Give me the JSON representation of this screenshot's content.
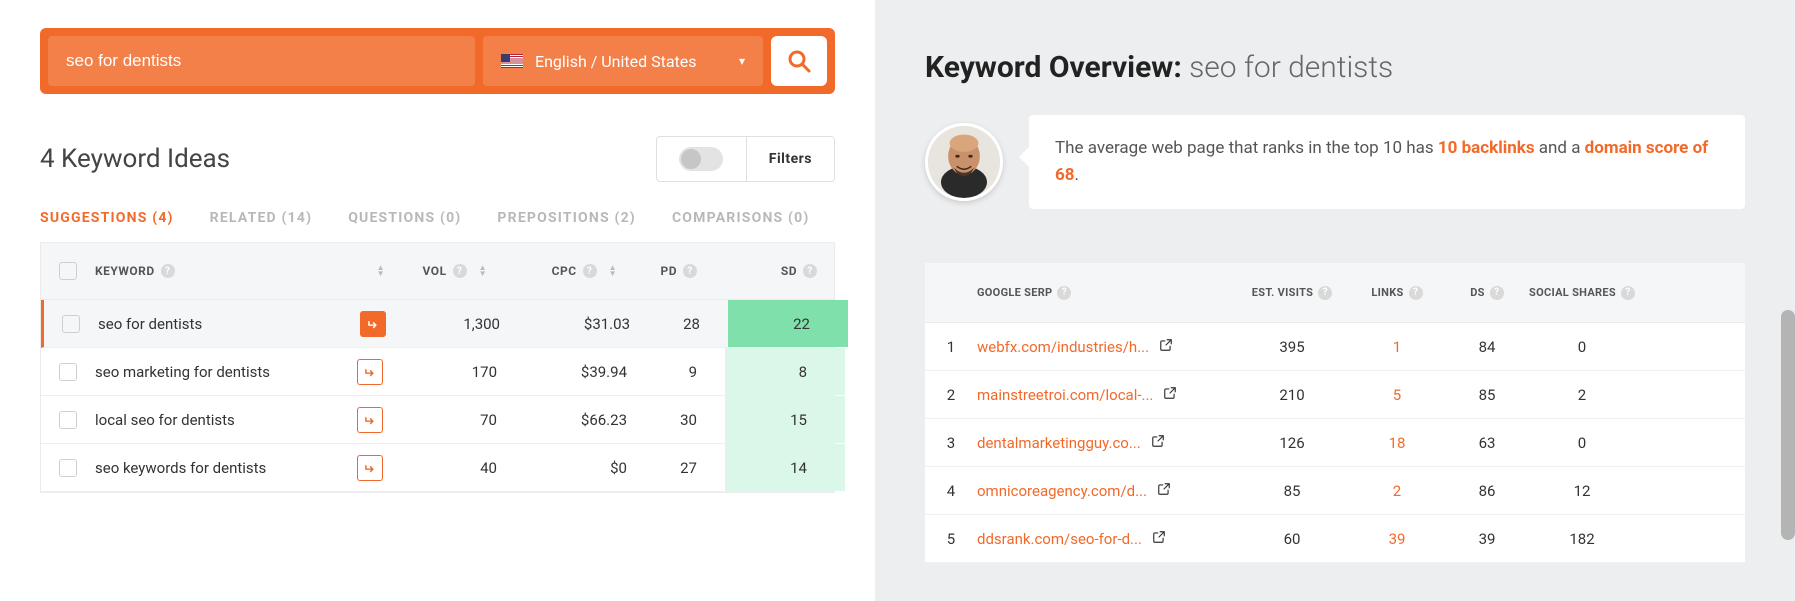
{
  "search": {
    "query": "seo for dentists",
    "language": "English / United States"
  },
  "ideas": {
    "title": "4 Keyword Ideas",
    "filters_label": "Filters"
  },
  "tabs": [
    {
      "label": "SUGGESTIONS (4)",
      "active": true
    },
    {
      "label": "RELATED (14)",
      "active": false
    },
    {
      "label": "QUESTIONS (0)",
      "active": false
    },
    {
      "label": "PREPOSITIONS (2)",
      "active": false
    },
    {
      "label": "COMPARISONS (0)",
      "active": false
    }
  ],
  "columns": {
    "keyword": "KEYWORD",
    "vol": "VOL",
    "cpc": "CPC",
    "pd": "PD",
    "sd": "SD"
  },
  "rows": [
    {
      "kw": "seo for dentists",
      "vol": "1,300",
      "cpc": "$31.03",
      "pd": "28",
      "sd": "22",
      "selected": true,
      "sd_class": "sd-dark"
    },
    {
      "kw": "seo marketing for dentists",
      "vol": "170",
      "cpc": "$39.94",
      "pd": "9",
      "sd": "8",
      "selected": false,
      "sd_class": "sd-light"
    },
    {
      "kw": "local seo for dentists",
      "vol": "70",
      "cpc": "$66.23",
      "pd": "30",
      "sd": "15",
      "selected": false,
      "sd_class": "sd-light"
    },
    {
      "kw": "seo keywords for dentists",
      "vol": "40",
      "cpc": "$0",
      "pd": "27",
      "sd": "14",
      "selected": false,
      "sd_class": "sd-light"
    }
  ],
  "overview": {
    "heading_bold": "Keyword Overview:",
    "heading_kw": "seo for dentists",
    "insight_pre": "The average web page that ranks in the top 10 has ",
    "insight_hl1": "10 backlinks",
    "insight_mid": " and a ",
    "insight_hl2": "domain score of 68",
    "insight_post": "."
  },
  "serp_columns": {
    "serp": "GOOGLE SERP",
    "visits": "EST. VISITS",
    "links": "LINKS",
    "ds": "DS",
    "shares": "SOCIAL SHARES"
  },
  "serp_rows": [
    {
      "rank": "1",
      "url": "webfx.com/industries/h...",
      "visits": "395",
      "links": "1",
      "ds": "84",
      "shares": "0"
    },
    {
      "rank": "2",
      "url": "mainstreetroi.com/local-...",
      "visits": "210",
      "links": "5",
      "ds": "85",
      "shares": "2"
    },
    {
      "rank": "3",
      "url": "dentalmarketingguy.co...",
      "visits": "126",
      "links": "18",
      "ds": "63",
      "shares": "0"
    },
    {
      "rank": "4",
      "url": "omnicoreagency.com/d...",
      "visits": "85",
      "links": "2",
      "ds": "86",
      "shares": "12"
    },
    {
      "rank": "5",
      "url": "ddsrank.com/seo-for-d...",
      "visits": "60",
      "links": "39",
      "ds": "39",
      "shares": "182"
    }
  ]
}
